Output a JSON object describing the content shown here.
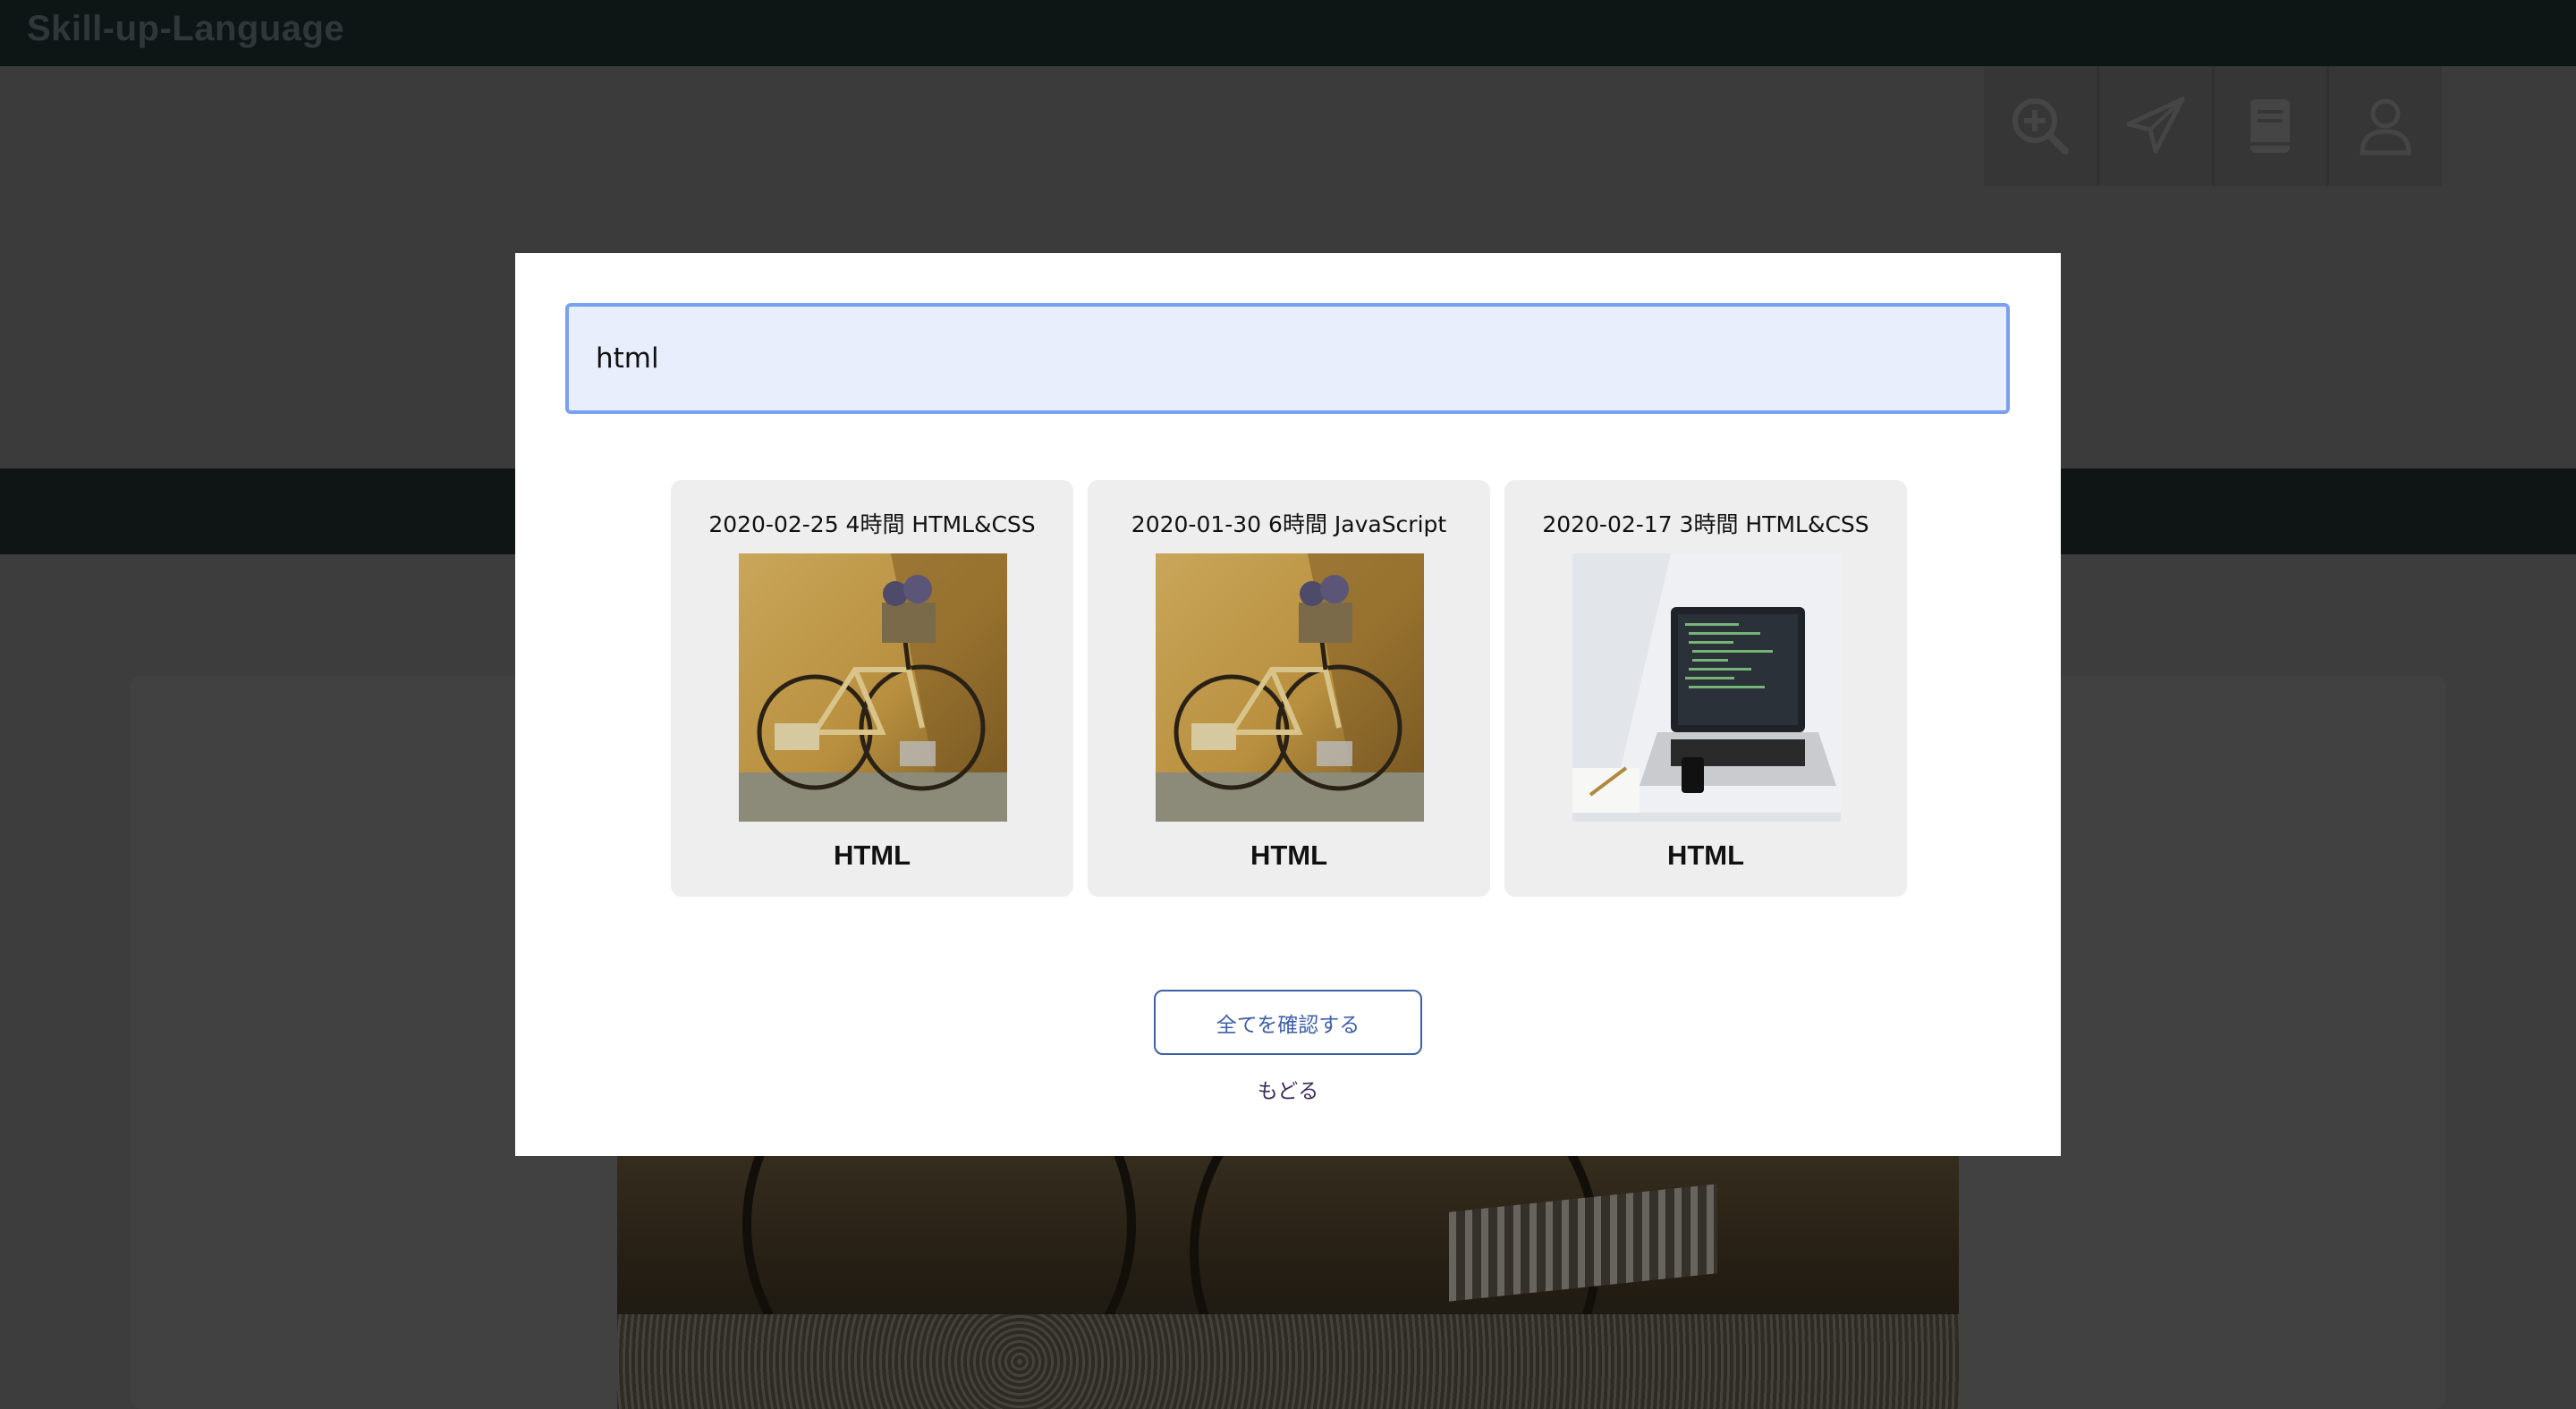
{
  "app": {
    "brand": "Skill-up-Language"
  },
  "header_icons": [
    {
      "name": "zoom-in-icon"
    },
    {
      "name": "paper-plane-icon"
    },
    {
      "name": "book-icon"
    },
    {
      "name": "user-icon"
    }
  ],
  "modal": {
    "search": {
      "value": "html"
    },
    "results": [
      {
        "meta": "2020-02-25 4時間 HTML&CSS",
        "title": "HTML",
        "image": "bicycle-photo"
      },
      {
        "meta": "2020-01-30 6時間 JavaScript",
        "title": "HTML",
        "image": "bicycle-photo"
      },
      {
        "meta": "2020-02-17 3時間 HTML&CSS",
        "title": "HTML",
        "image": "laptop-photo"
      }
    ],
    "confirm_label": "全てを確認する",
    "back_label": "もどる"
  },
  "colors": {
    "topbar": "#1d2b2a",
    "accent": "#3d5fa8",
    "input_border": "#7aa0f0",
    "input_bg": "#e8eefc",
    "card_bg": "#eeeeee"
  }
}
